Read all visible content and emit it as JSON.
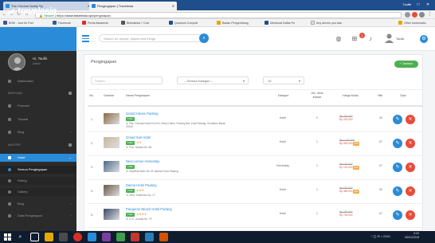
{
  "browser": {
    "tabs": [
      {
        "title": "The Chrome family Sp"
      },
      {
        "title": "Pengingapan | Travelesia"
      }
    ],
    "user": "Taufik",
    "url_secure": "Secure",
    "url_prefix": "https://",
    "url_domain": "www.travelesia.xyz",
    "url_path": "/penginapan",
    "bookmarks": [
      {
        "label": "BSKI - Just for Fun!",
        "color": "#3b5998"
      },
      {
        "label": "Facebook",
        "color": "#3b5998"
      },
      {
        "label": "Portal Akademik",
        "color": "#d93025"
      },
      {
        "label": "Bhimateka 7 Coin",
        "color": "#555555"
      },
      {
        "label": "Quantum Computi",
        "color": "#1f4e8c"
      },
      {
        "label": "Badan Pengembang",
        "color": "#e6a700"
      },
      {
        "label": "Membuat Daftar Pu",
        "color": "#1f4e8c"
      },
      {
        "label": "Any drivers you wan",
        "color": "#dddddd"
      },
      {
        "label": "Other bookmarks",
        "color": "#e6a700"
      }
    ]
  },
  "app": {
    "brand": "travelesia",
    "search_placeholder": "Search for people, places and things",
    "notif_count": "1",
    "user_name": "Taufik",
    "sidebar": {
      "profile_name": "Hi, Taufik",
      "profile_role": "Admin",
      "items": [
        {
          "label": "Dashboard"
        },
        {
          "section": "BANTUAN"
        },
        {
          "label": "Promosi"
        },
        {
          "label": "Tutorial"
        },
        {
          "label": "Blog"
        },
        {
          "section": "MASTER"
        },
        {
          "label": "Hotel"
        },
        {
          "label": "Semua Pengingapan"
        },
        {
          "label": "Rating"
        },
        {
          "label": "Gallery"
        },
        {
          "label": "Blog"
        },
        {
          "label": "Data Penginapan"
        }
      ]
    },
    "page_title": "Pengingapan",
    "add_button": "+ Tambah",
    "filters": {
      "search_placeholder": "Search...",
      "kategori": "-- Semua Kategori --",
      "limit": "10"
    },
    "table": {
      "headers": [
        "No.",
        "Gambar",
        "Nama Penginapan",
        "Kategori",
        "Jml. Jenis Kamar",
        "Harga Mulai",
        "Hits",
        "Opsi"
      ],
      "rows": [
        {
          "no": "1.",
          "name": "Grand House Padang",
          "badge": "LIVE",
          "stars": "",
          "addr": "Jl. Pdk. Cemara Indah No.004, Bunyi Harini, Padang Bar, Kota Padang, Sumatera Barat 25118",
          "kategori": "Hotel",
          "kamar": "2",
          "old": "Rp 250.000",
          "new": "Rp 200.000",
          "disc": "",
          "hits": "32",
          "thumb": "#8a6a4a"
        },
        {
          "no": "2.",
          "name": "Grand Sari Hotel",
          "badge": "LIVE",
          "stars": "★★",
          "addr": "Jl. Prof. Hamka No. 88",
          "kategori": "Hotel",
          "kamar": "1",
          "old": "Rp 1.000.000",
          "new": "Rp 800.000",
          "disc": "20%",
          "hits": "07",
          "thumb": "#c8b8a0"
        },
        {
          "no": "3.",
          "name": "New Lemon Homestay",
          "badge": "LIVE",
          "stars": "",
          "addr": "Jl. Sawahan Baru No.29 Jalanan Kota Padang",
          "kategori": "Homestay",
          "kamar": "1",
          "old": "Rp 150.000",
          "new": "Rp 120.000",
          "disc": "20%",
          "hits": "07",
          "thumb": "#4a6a8a"
        },
        {
          "no": "4.",
          "name": "Daima Hotel Padang",
          "badge": "LIVE",
          "stars": "★★★",
          "addr": "Jl. Jend. Sudirman No. 17",
          "kategori": "Hotel",
          "kamar": "1",
          "old": "Rp 600.000",
          "new": "Rp 480.000",
          "disc": "20%",
          "hits": "02",
          "thumb": "#6a5a4a"
        },
        {
          "no": "5.",
          "name": "Pangeran Beach Hotel Padang",
          "badge": "LIVE",
          "stars": "★★★★",
          "addr": "Jl. Ir. H. Juanda No. 79",
          "kategori": "Hotel",
          "kamar": "1",
          "old": "Rp 750.000",
          "new": "Rp 700.000",
          "disc": "",
          "hits": "07",
          "thumb": "#3a4a6a"
        }
      ]
    }
  },
  "taskbar": {
    "time": "9:03",
    "date": "26/01/2018",
    "lang": "ENG"
  }
}
